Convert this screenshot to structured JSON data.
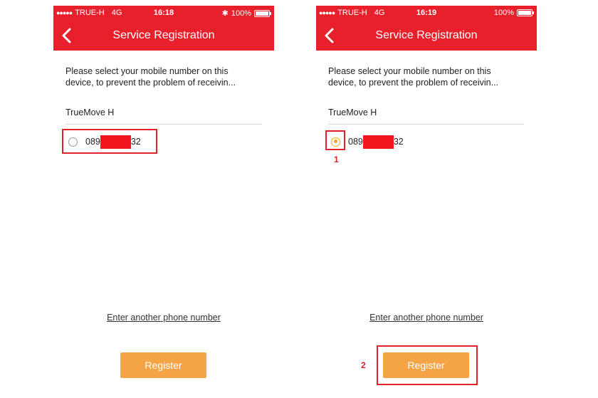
{
  "left": {
    "status": {
      "signal_dots": "●●●●●",
      "carrier": "TRUE-H",
      "network": "4G",
      "time": "16:18",
      "bluetooth": "✱",
      "battery": "100%"
    },
    "header": {
      "title": "Service Registration"
    },
    "description": {
      "line1": "Please select your mobile number on this",
      "line2": "device, to prevent the problem of receivin..."
    },
    "carrier_label": "TrueMove H",
    "number": {
      "prefix": "089",
      "suffix": "32",
      "selected": false
    },
    "link": "Enter another phone number",
    "register": "Register"
  },
  "right": {
    "status": {
      "signal_dots": "●●●●●",
      "carrier": "TRUE-H",
      "network": "4G",
      "time": "16:19",
      "battery": "100%"
    },
    "header": {
      "title": "Service Registration"
    },
    "description": {
      "line1": "Please select your mobile number on this",
      "line2": "device, to prevent the problem of receivin..."
    },
    "carrier_label": "TrueMove H",
    "number": {
      "prefix": "089",
      "suffix": "32",
      "selected": true
    },
    "link": "Enter another phone number",
    "register": "Register"
  },
  "annotations": {
    "step1": "1",
    "step2": "2"
  },
  "colors": {
    "header": "#e8202c",
    "button": "#f5a445",
    "highlight": "#e0222a",
    "radio_selected": "#f5a623"
  },
  "icons": {
    "back": "chevron-left-icon",
    "bluetooth": "bluetooth-icon",
    "battery": "battery-icon",
    "radio": "radio-button-icon"
  }
}
